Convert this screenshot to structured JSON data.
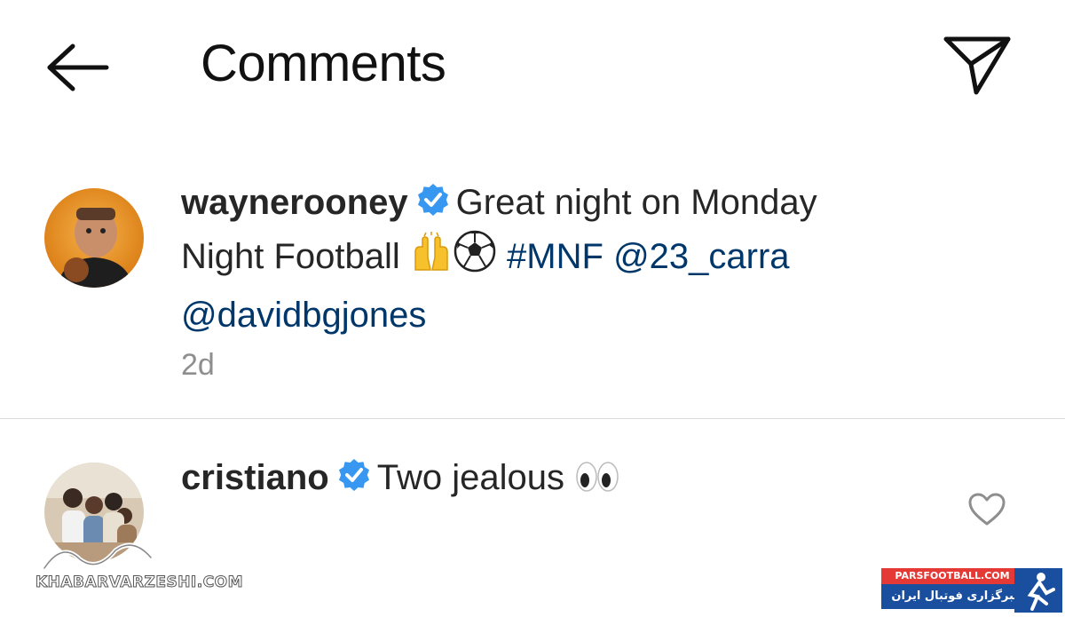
{
  "header": {
    "title": "Comments"
  },
  "post": {
    "username": "waynerooney",
    "caption_text": "Great night on Monday Night Football",
    "emojis": [
      "raising-hands",
      "soccer-ball"
    ],
    "hashtag": "#MNF",
    "mentions": [
      "@23_carra",
      "@davidbgjones"
    ],
    "time": "2d"
  },
  "comments": [
    {
      "username": "cristiano",
      "text": "Two jealous",
      "emoji": "eyes"
    }
  ],
  "watermarks": {
    "left_text": "KHABARVARZESHI.COM",
    "right_top": "PARSFOOTBALL.COM",
    "right_bottom": "خبرگزاری فوتبال ایران"
  },
  "colors": {
    "verified": "#3897f0",
    "link": "#00376b",
    "secondary_text": "#8e8e8e",
    "divider": "#dbdbdb"
  }
}
